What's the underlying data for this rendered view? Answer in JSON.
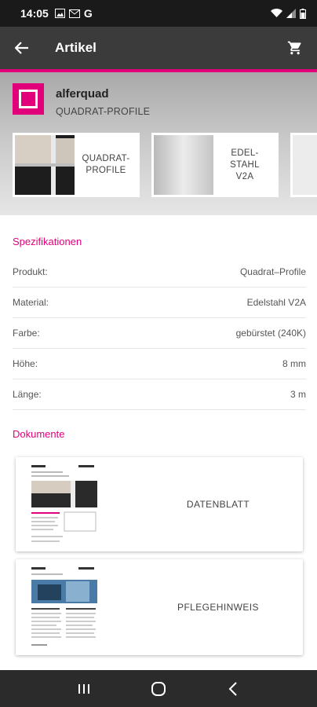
{
  "status_bar": {
    "time": "14:05",
    "carrier_glyph": "G"
  },
  "app_bar": {
    "title": "Artikel"
  },
  "product": {
    "brand": "alferquad",
    "subtitle": "QUADRAT-PROFILE",
    "variants": [
      {
        "label": "QUADRAT-\nPROFILE"
      },
      {
        "label": "EDEL-\nSTAHL\nV2A"
      },
      {
        "label": ""
      }
    ]
  },
  "specs": {
    "title": "Spezifikationen",
    "rows": [
      {
        "key": "Produkt:",
        "value": "Quadrat–Profile"
      },
      {
        "key": "Material:",
        "value": "Edelstahl V2A"
      },
      {
        "key": "Farbe:",
        "value": "gebürstet (240K)"
      },
      {
        "key": "Höhe:",
        "value": "8 mm"
      },
      {
        "key": "Länge:",
        "value": "3 m"
      }
    ]
  },
  "documents": {
    "title": "Dokumente",
    "items": [
      {
        "label": "DATENBLATT"
      },
      {
        "label": "PFLEGEHINWEIS"
      }
    ]
  },
  "colors": {
    "accent": "#e2007a",
    "app_bar": "#3b3b3b",
    "status_bar": "#1a1a1a"
  },
  "icons": {
    "status": [
      "image-icon",
      "mail-icon",
      "wifi-icon",
      "signal-icon",
      "battery-icon"
    ],
    "app_bar": [
      "back-arrow-icon",
      "cart-icon"
    ],
    "nav": [
      "recent-apps-icon",
      "home-icon",
      "back-icon"
    ]
  }
}
